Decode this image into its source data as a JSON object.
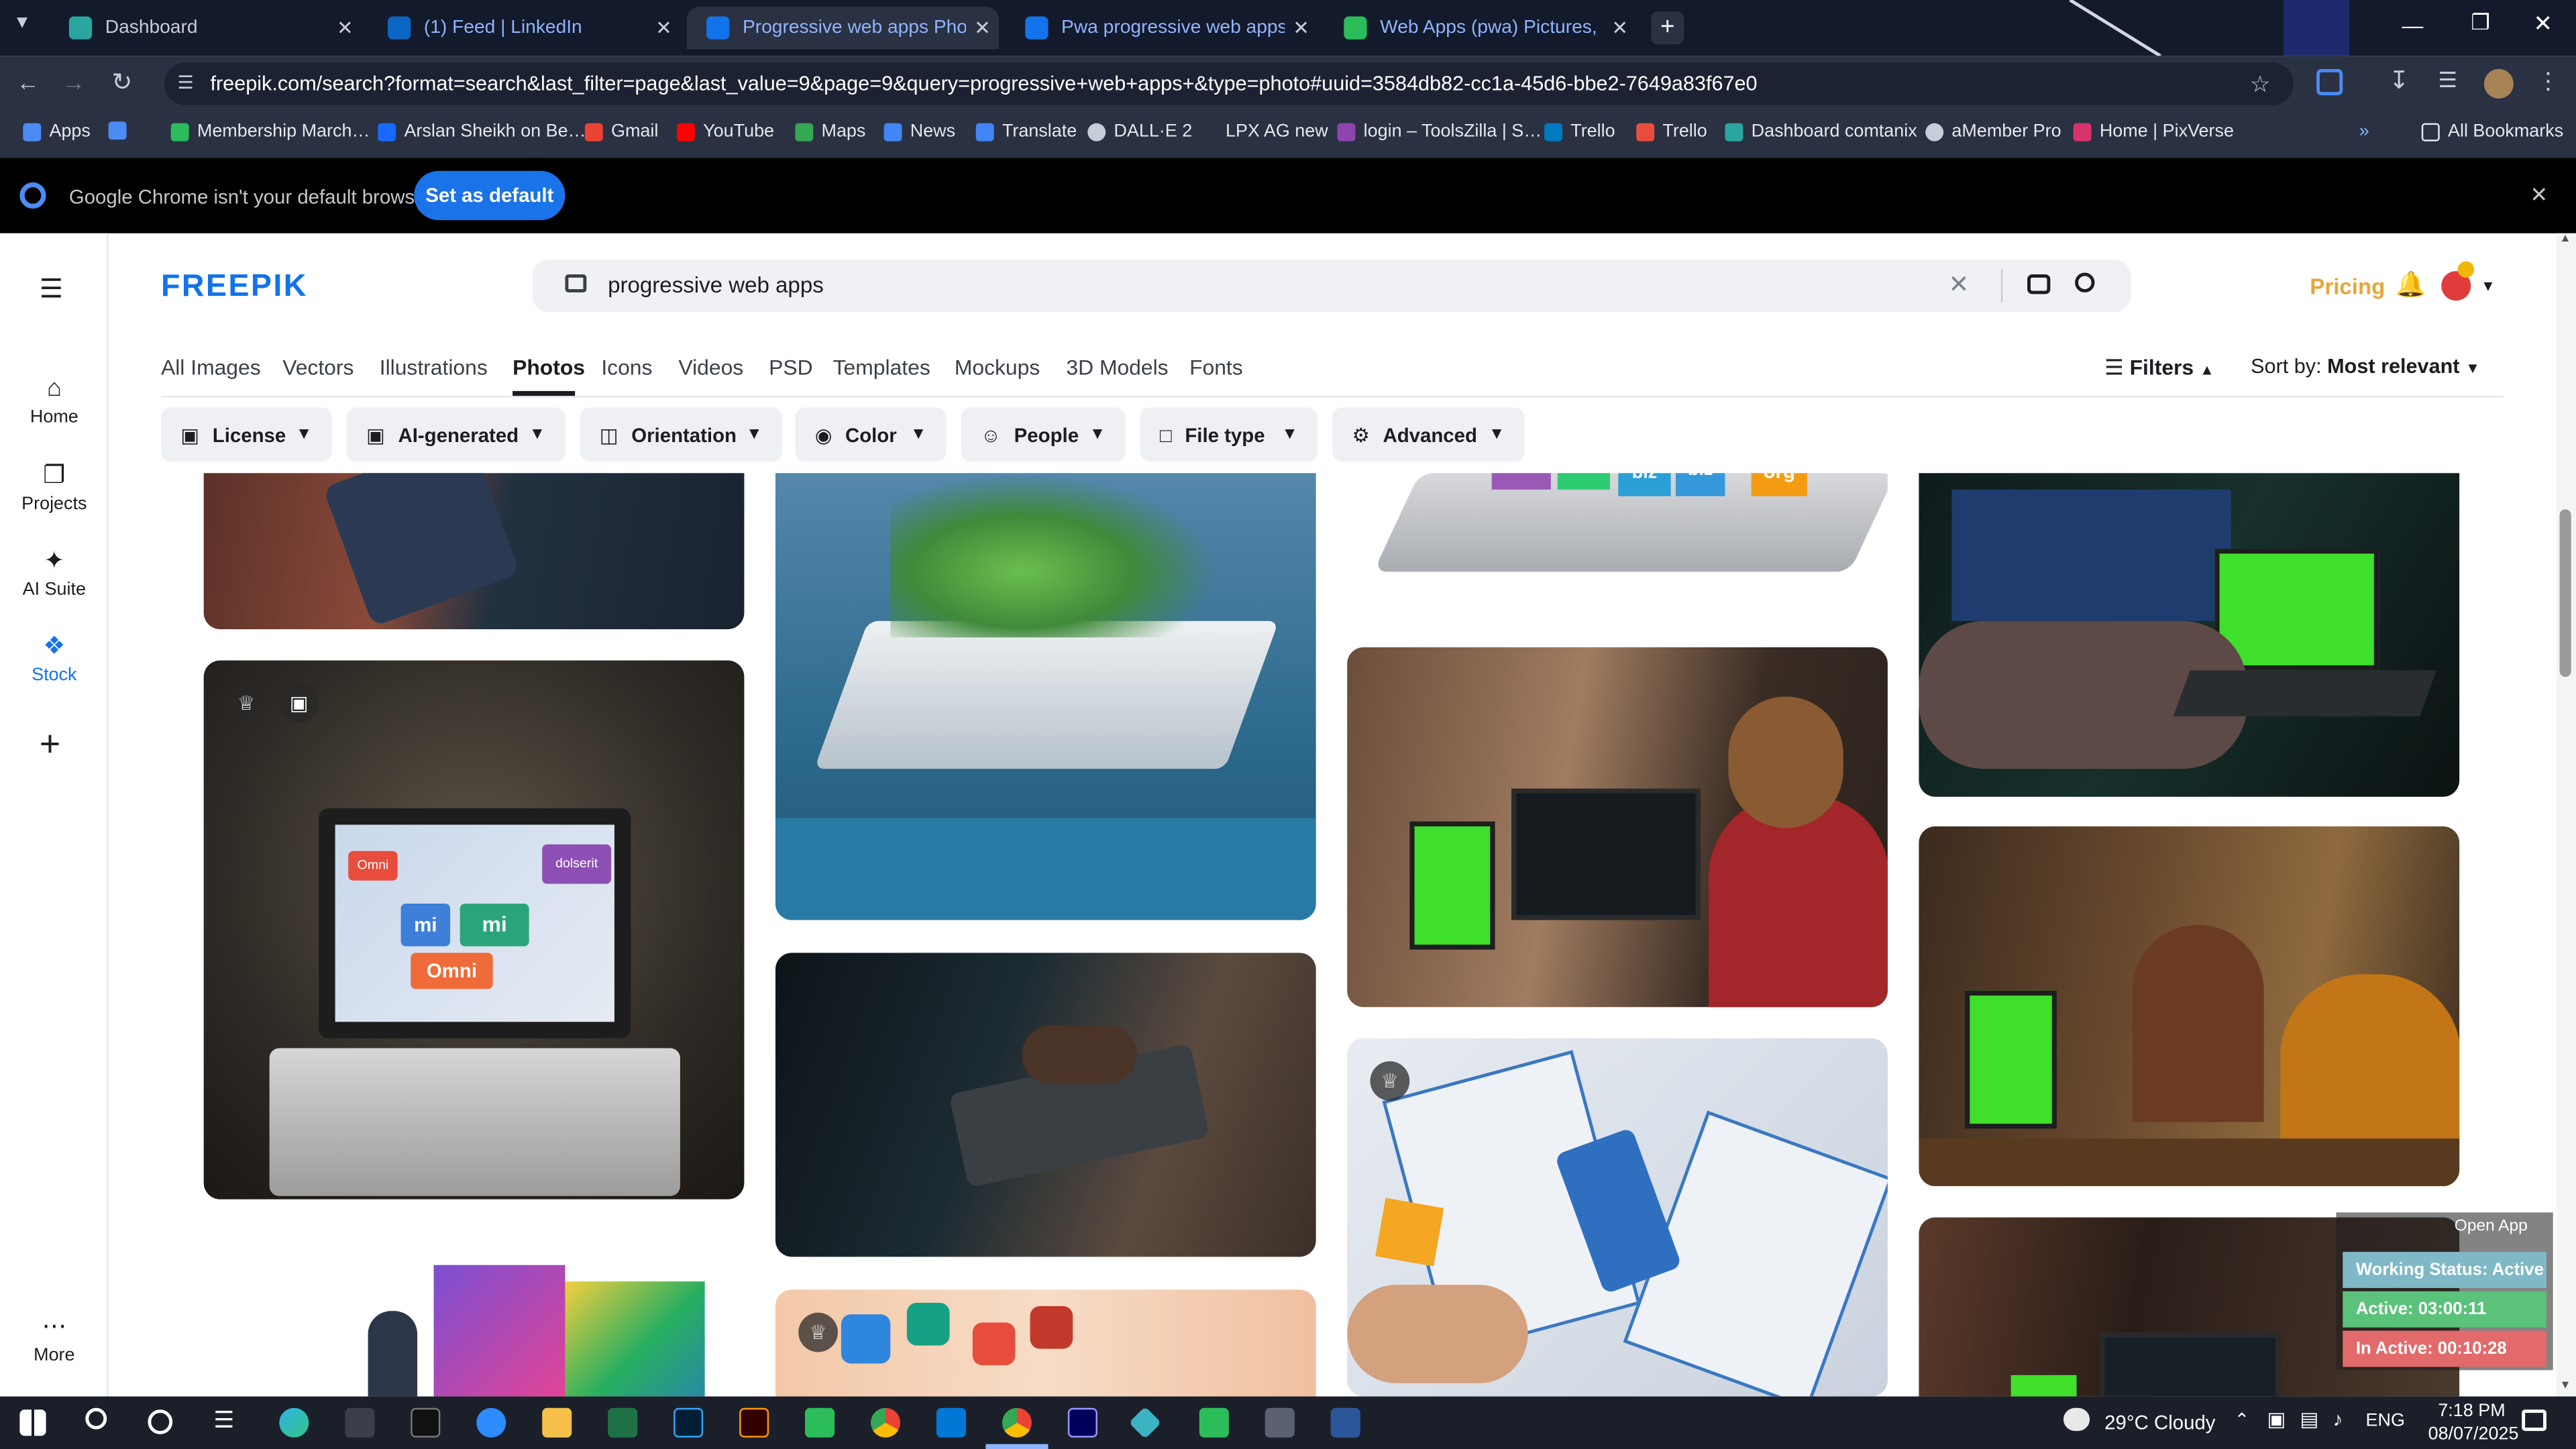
{
  "tabs": [
    {
      "title": "Dashboard",
      "color": "#2aa5a0"
    },
    {
      "title": "(1) Feed | LinkedIn",
      "color": "#0a66c2"
    },
    {
      "title": "Progressive web apps Photos | …",
      "color": "#1273eb"
    },
    {
      "title": "Pwa progressive web apps sma…",
      "color": "#1273eb"
    },
    {
      "title": "Web Apps (pwa) Pictures, Imag…",
      "color": "#2cbd5a"
    }
  ],
  "address": "freepik.com/search?format=search&last_filter=page&last_value=9&page=9&query=progressive+web+apps+&type=photo#uuid=3584db82-cc1a-45d6-bbe2-7649a83f67e0",
  "bookmarks": [
    "Apps",
    "Membership March…",
    "Arslan Sheikh on Be…",
    "Gmail",
    "YouTube",
    "Maps",
    "News",
    "Translate",
    "DALL·E 2",
    "LPX AG new",
    "login – ToolsZilla | S…",
    "Trello",
    "Trello",
    "Dashboard comtanix",
    "aMember Pro",
    "Home | PixVerse"
  ],
  "all_bookmarks": "All Bookmarks",
  "infobar": {
    "text": "Google Chrome isn't your default browser",
    "button": "Set as default"
  },
  "sidebar": [
    {
      "label": "Home",
      "icon": "home-icon"
    },
    {
      "label": "Projects",
      "icon": "projects-icon"
    },
    {
      "label": "AI Suite",
      "icon": "ai-suite-icon"
    },
    {
      "label": "Stock",
      "icon": "stock-icon"
    },
    {
      "label": "More",
      "icon": "more-icon"
    }
  ],
  "logo": "FREEPIK",
  "search": {
    "value": "progressive web apps"
  },
  "pricing": "Pricing",
  "nav": [
    "All Images",
    "Vectors",
    "Illustrations",
    "Photos",
    "Icons",
    "Videos",
    "PSD",
    "Templates",
    "Mockups",
    "3D Models",
    "Fonts"
  ],
  "active_nav": "Photos",
  "filters_label": "Filters",
  "sort": {
    "label": "Sort by:",
    "value": "Most relevant"
  },
  "filters": [
    "License",
    "AI-generated",
    "Orientation",
    "Color",
    "People",
    "File type",
    "Advanced"
  ],
  "laptop_screen_text": [
    "Omni",
    "mi",
    "mi",
    "dolserit",
    "Omni"
  ],
  "cube_labels": [
    "biz",
    "biz",
    "org"
  ],
  "overlay": {
    "open_app": "Open App",
    "status": "Working Status: Active",
    "active": "Active: 03:00:11",
    "inactive": "In Active: 00:10:28"
  },
  "taskbar": {
    "weather": "29°C  Cloudy",
    "lang": "ENG",
    "time": "7:18 PM",
    "date": "08/07/2025"
  }
}
